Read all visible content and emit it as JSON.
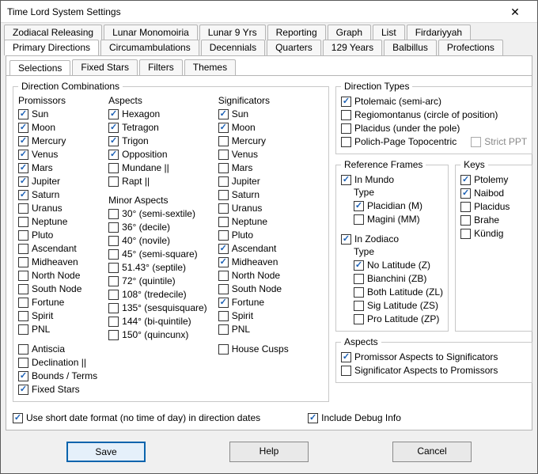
{
  "window": {
    "title": "Time Lord System Settings",
    "close": "✕"
  },
  "tabsRow1": [
    "Zodiacal Releasing",
    "Lunar Monomoiria",
    "Lunar 9 Yrs",
    "Reporting",
    "Graph",
    "List",
    "Firdariyyah"
  ],
  "tabsRow2": [
    "Primary Directions",
    "Circumambulations",
    "Decennials",
    "Quarters",
    "129 Years",
    "Balbillus",
    "Profections"
  ],
  "subtabs": [
    "Selections",
    "Fixed Stars",
    "Filters",
    "Themes"
  ],
  "direction_combinations": {
    "legend": "Direction Combinations",
    "promissors": {
      "head": "Promissors",
      "items": [
        {
          "label": "Sun",
          "checked": true
        },
        {
          "label": "Moon",
          "checked": true
        },
        {
          "label": "Mercury",
          "checked": true
        },
        {
          "label": "Venus",
          "checked": true
        },
        {
          "label": "Mars",
          "checked": true
        },
        {
          "label": "Jupiter",
          "checked": true
        },
        {
          "label": "Saturn",
          "checked": true
        },
        {
          "label": "Uranus",
          "checked": false
        },
        {
          "label": "Neptune",
          "checked": false
        },
        {
          "label": "Pluto",
          "checked": false
        },
        {
          "label": "Ascendant",
          "checked": false
        },
        {
          "label": "Midheaven",
          "checked": false
        },
        {
          "label": "North Node",
          "checked": false
        },
        {
          "label": "South Node",
          "checked": false
        },
        {
          "label": "Fortune",
          "checked": false
        },
        {
          "label": "Spirit",
          "checked": false
        },
        {
          "label": "PNL",
          "checked": false
        }
      ],
      "extra": [
        {
          "label": "Antiscia",
          "checked": false
        },
        {
          "label": "Declination ||",
          "checked": false
        },
        {
          "label": "Bounds / Terms",
          "checked": true
        },
        {
          "label": "Fixed Stars",
          "checked": true
        }
      ]
    },
    "aspects": {
      "head": "Aspects",
      "items": [
        {
          "label": "Hexagon",
          "checked": true
        },
        {
          "label": "Tetragon",
          "checked": true
        },
        {
          "label": "Trigon",
          "checked": true
        },
        {
          "label": "Opposition",
          "checked": true
        },
        {
          "label": "Mundane ||",
          "checked": false
        },
        {
          "label": "Rapt ||",
          "checked": false
        }
      ],
      "minor_head": "Minor Aspects",
      "minor": [
        {
          "label": "30° (semi-sextile)",
          "checked": false
        },
        {
          "label": "36° (decile)",
          "checked": false
        },
        {
          "label": "40° (novile)",
          "checked": false
        },
        {
          "label": "45° (semi-square)",
          "checked": false
        },
        {
          "label": "51.43° (septile)",
          "checked": false
        },
        {
          "label": "72° (quintile)",
          "checked": false
        },
        {
          "label": "108° (tredecile)",
          "checked": false
        },
        {
          "label": "135° (sesquisquare)",
          "checked": false
        },
        {
          "label": "144° (bi-quintile)",
          "checked": false
        },
        {
          "label": "150° (quincunx)",
          "checked": false
        }
      ]
    },
    "significators": {
      "head": "Significators",
      "items": [
        {
          "label": "Sun",
          "checked": true
        },
        {
          "label": "Moon",
          "checked": true
        },
        {
          "label": "Mercury",
          "checked": false
        },
        {
          "label": "Venus",
          "checked": false
        },
        {
          "label": "Mars",
          "checked": false
        },
        {
          "label": "Jupiter",
          "checked": false
        },
        {
          "label": "Saturn",
          "checked": false
        },
        {
          "label": "Uranus",
          "checked": false
        },
        {
          "label": "Neptune",
          "checked": false
        },
        {
          "label": "Pluto",
          "checked": false
        },
        {
          "label": "Ascendant",
          "checked": true
        },
        {
          "label": "Midheaven",
          "checked": true
        },
        {
          "label": "North Node",
          "checked": false
        },
        {
          "label": "South Node",
          "checked": false
        },
        {
          "label": "Fortune",
          "checked": true
        },
        {
          "label": "Spirit",
          "checked": false
        },
        {
          "label": "PNL",
          "checked": false
        }
      ],
      "extra": [
        {
          "label": "House Cusps",
          "checked": false
        }
      ]
    }
  },
  "direction_types": {
    "legend": "Direction Types",
    "items": [
      {
        "label": "Ptolemaic (semi-arc)",
        "checked": true
      },
      {
        "label": "Regiomontanus (circle of position)",
        "checked": false
      },
      {
        "label": "Placidus (under the pole)",
        "checked": false
      },
      {
        "label": "Polich-Page Topocentric",
        "checked": false
      }
    ],
    "strict": {
      "label": "Strict PPT",
      "checked": false,
      "disabled": true
    }
  },
  "reference_frames": {
    "legend": "Reference Frames",
    "mundo": {
      "label": "In Mundo",
      "checked": true
    },
    "mundo_type_head": "Type",
    "mundo_types": [
      {
        "label": "Placidian (M)",
        "checked": true
      },
      {
        "label": "Magini (MM)",
        "checked": false
      }
    ],
    "zodiaco": {
      "label": "In Zodiaco",
      "checked": true
    },
    "zodiaco_type_head": "Type",
    "zodiaco_types": [
      {
        "label": "No Latitude (Z)",
        "checked": true
      },
      {
        "label": "Bianchini (ZB)",
        "checked": false
      },
      {
        "label": "Both Latitude (ZL)",
        "checked": false
      },
      {
        "label": "Sig Latitude (ZS)",
        "checked": false
      },
      {
        "label": "Pro Latitude (ZP)",
        "checked": false
      }
    ]
  },
  "keys": {
    "legend": "Keys",
    "items": [
      {
        "label": "Ptolemy",
        "checked": true
      },
      {
        "label": "Naibod",
        "checked": true
      },
      {
        "label": "Placidus",
        "checked": false
      },
      {
        "label": "Brahe",
        "checked": false
      },
      {
        "label": "Kündig",
        "checked": false
      }
    ]
  },
  "aspect_dir": {
    "legend": "Aspects",
    "items": [
      {
        "label": "Promissor Aspects to Significators",
        "checked": true
      },
      {
        "label": "Significator Aspects to Promissors",
        "checked": false
      }
    ]
  },
  "bottom": {
    "short_date": {
      "label": "Use short date format (no time of day) in direction dates",
      "checked": true
    },
    "debug": {
      "label": "Include Debug Info",
      "checked": true
    }
  },
  "buttons": {
    "save": "Save",
    "help": "Help",
    "cancel": "Cancel"
  }
}
